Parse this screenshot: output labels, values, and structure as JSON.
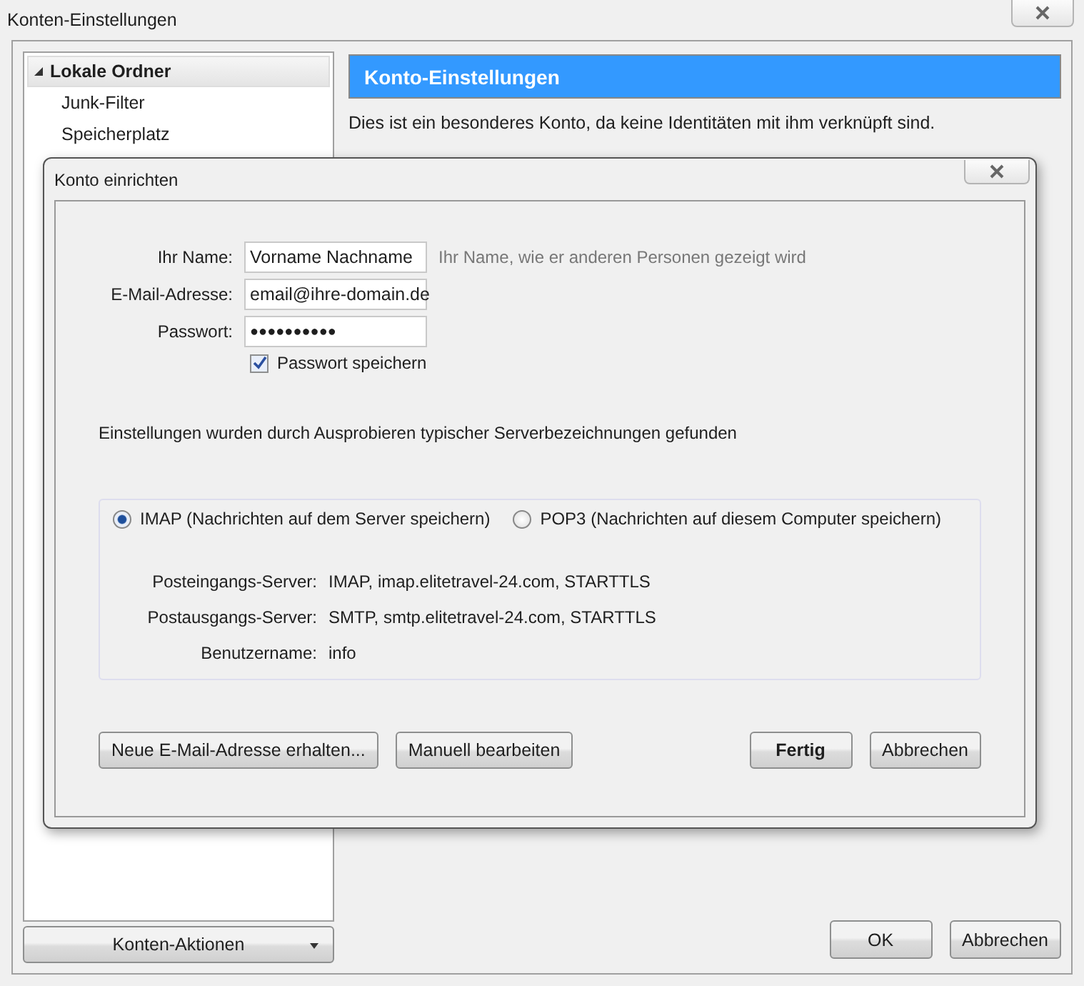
{
  "window": {
    "title": "Konten-Einstellungen"
  },
  "sidebar": {
    "items": [
      {
        "label": "Lokale Ordner",
        "expanded": true,
        "selected": true,
        "children": [
          {
            "label": "Junk-Filter",
            "selected": false
          },
          {
            "label": "Speicherplatz",
            "selected": false
          }
        ]
      }
    ],
    "actions_button": "Konten-Aktionen"
  },
  "panel": {
    "title": "Konto-Einstellungen",
    "description": "Dies ist ein besonderes Konto, da keine Identitäten mit ihm verknüpft sind."
  },
  "buttons": [
    "OK",
    "Abbrechen"
  ],
  "dialog": {
    "title": "Konto einrichten",
    "fields": [
      {
        "label": "Ihr Name:",
        "value": "Vorname Nachname",
        "hint": "Ihr Name, wie er anderen Personen gezeigt wird"
      },
      {
        "label": "E-Mail-Adresse:",
        "value": "email@ihre-domain.de"
      },
      {
        "label": "Passwort:",
        "value": "●●●●●●●●●●"
      }
    ],
    "remember_password": {
      "label": "Passwort speichern",
      "checked": true
    },
    "status": "Einstellungen wurden durch Ausprobieren typischer Serverbezeichnungen gefunden",
    "protocols": [
      {
        "label": "IMAP (Nachrichten auf dem Server speichern)",
        "selected": true
      },
      {
        "label": "POP3 (Nachrichten auf diesem Computer speichern)",
        "selected": false
      }
    ],
    "servers": [
      {
        "label": "Posteingangs-Server:",
        "value": "IMAP, imap.elitetravel-24.com, STARTTLS"
      },
      {
        "label": "Postausgangs-Server:",
        "value": "SMTP, smtp.elitetravel-24.com, STARTTLS"
      },
      {
        "label": "Benutzername:",
        "value": "info"
      }
    ],
    "left_buttons": [
      {
        "label": "Neue E-Mail-Adresse erhalten...",
        "default": false
      },
      {
        "label": "Manuell bearbeiten",
        "default": false
      }
    ],
    "right_buttons": [
      {
        "label": "Fertig",
        "default": true
      },
      {
        "label": "Abbrechen",
        "default": false
      }
    ]
  }
}
